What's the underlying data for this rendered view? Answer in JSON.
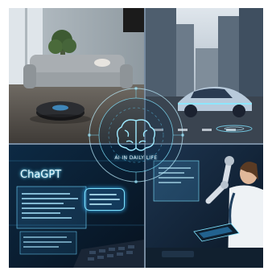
{
  "hub": {
    "label": "AI IN DAILY LIFE"
  },
  "screen": {
    "title": "ChaGPT"
  },
  "icons": [
    "brain-icon",
    "robot-vacuum",
    "electric-car",
    "robot-arm",
    "tablet"
  ],
  "colors": {
    "glow": "#5fd4ff",
    "night": "#0b1a2b",
    "hud": "#36b8ff"
  }
}
